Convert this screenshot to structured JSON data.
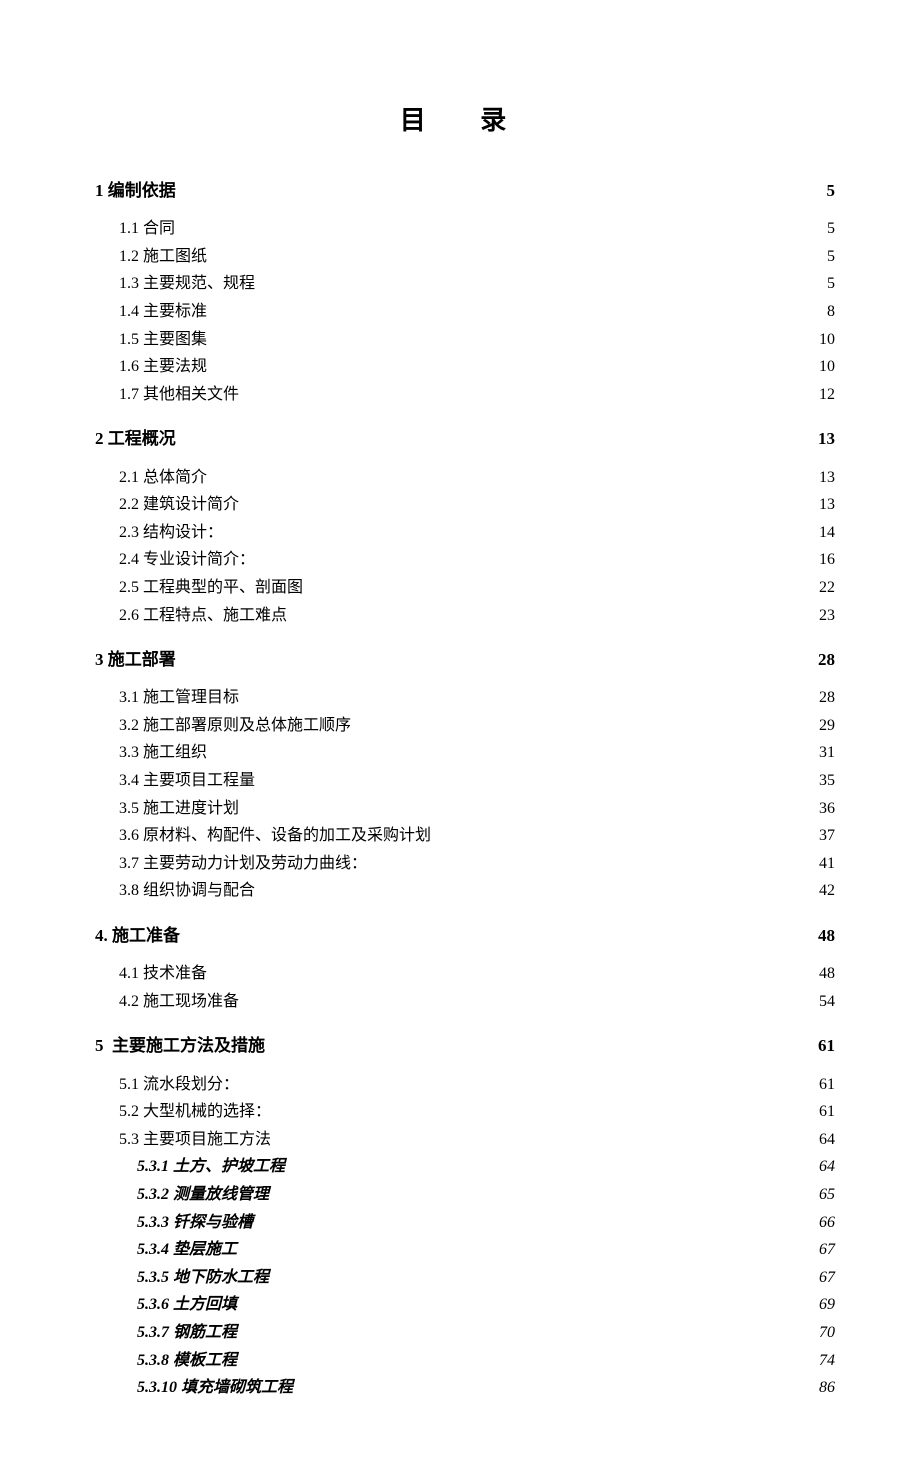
{
  "title": "目  录",
  "sections": [
    {
      "label": "1 编制依据",
      "page": "5"
    },
    {
      "label": "2 工程概况",
      "page": "13"
    },
    {
      "label": "3 施工部署",
      "page": "28"
    },
    {
      "label": "4. 施工准备",
      "page": "48"
    },
    {
      "label": "5  主要施工方法及措施",
      "page": "61"
    }
  ],
  "s1": [
    {
      "label": "1.1 合同",
      "page": "5"
    },
    {
      "label": "1.2 施工图纸",
      "page": "5"
    },
    {
      "label": "1.3 主要规范、规程",
      "page": "5"
    },
    {
      "label": "1.4 主要标准",
      "page": "8"
    },
    {
      "label": "1.5 主要图集",
      "page": "10"
    },
    {
      "label": "1.6 主要法规",
      "page": "10"
    },
    {
      "label": "1.7 其他相关文件",
      "page": "12"
    }
  ],
  "s2": [
    {
      "label": "2.1 总体简介",
      "page": "13"
    },
    {
      "label": "2.2 建筑设计简介",
      "page": "13"
    },
    {
      "label": "2.3 结构设计：",
      "page": "14"
    },
    {
      "label": "2.4 专业设计简介：",
      "page": "16"
    },
    {
      "label": "2.5 工程典型的平、剖面图",
      "page": "22"
    },
    {
      "label": "2.6 工程特点、施工难点",
      "page": "23"
    }
  ],
  "s3": [
    {
      "label": "3.1 施工管理目标",
      "page": "28"
    },
    {
      "label": "3.2 施工部署原则及总体施工顺序",
      "page": "29"
    },
    {
      "label": "3.3 施工组织",
      "page": "31"
    },
    {
      "label": "3.4 主要项目工程量",
      "page": "35"
    },
    {
      "label": "3.5 施工进度计划",
      "page": "36"
    },
    {
      "label": "3.6 原材料、构配件、设备的加工及采购计划",
      "page": "37"
    },
    {
      "label": "3.7 主要劳动力计划及劳动力曲线：",
      "page": "41"
    },
    {
      "label": "3.8 组织协调与配合",
      "page": "42"
    }
  ],
  "s4": [
    {
      "label": "4.1 技术准备",
      "page": "48"
    },
    {
      "label": "4.2 施工现场准备",
      "page": "54"
    }
  ],
  "s5": [
    {
      "label": "5.1 流水段划分：",
      "page": "61"
    },
    {
      "label": "5.2 大型机械的选择：",
      "page": "61"
    },
    {
      "label": "5.3 主要项目施工方法",
      "page": "64"
    }
  ],
  "s53": [
    {
      "label": "5.3.1 土方、护坡工程",
      "page": "64"
    },
    {
      "label": "5.3.2 测量放线管理",
      "page": "65"
    },
    {
      "label": "5.3.3 钎探与验槽",
      "page": "66"
    },
    {
      "label": "5.3.4 垫层施工",
      "page": "67"
    },
    {
      "label": "5.3.5 地下防水工程",
      "page": "67"
    },
    {
      "label": "5.3.6 土方回填",
      "page": "69"
    },
    {
      "label": "5.3.7 钢筋工程",
      "page": "70"
    },
    {
      "label": "5.3.8 模板工程",
      "page": "74"
    },
    {
      "label": "5.3.10 填充墙砌筑工程",
      "page": "86"
    }
  ]
}
